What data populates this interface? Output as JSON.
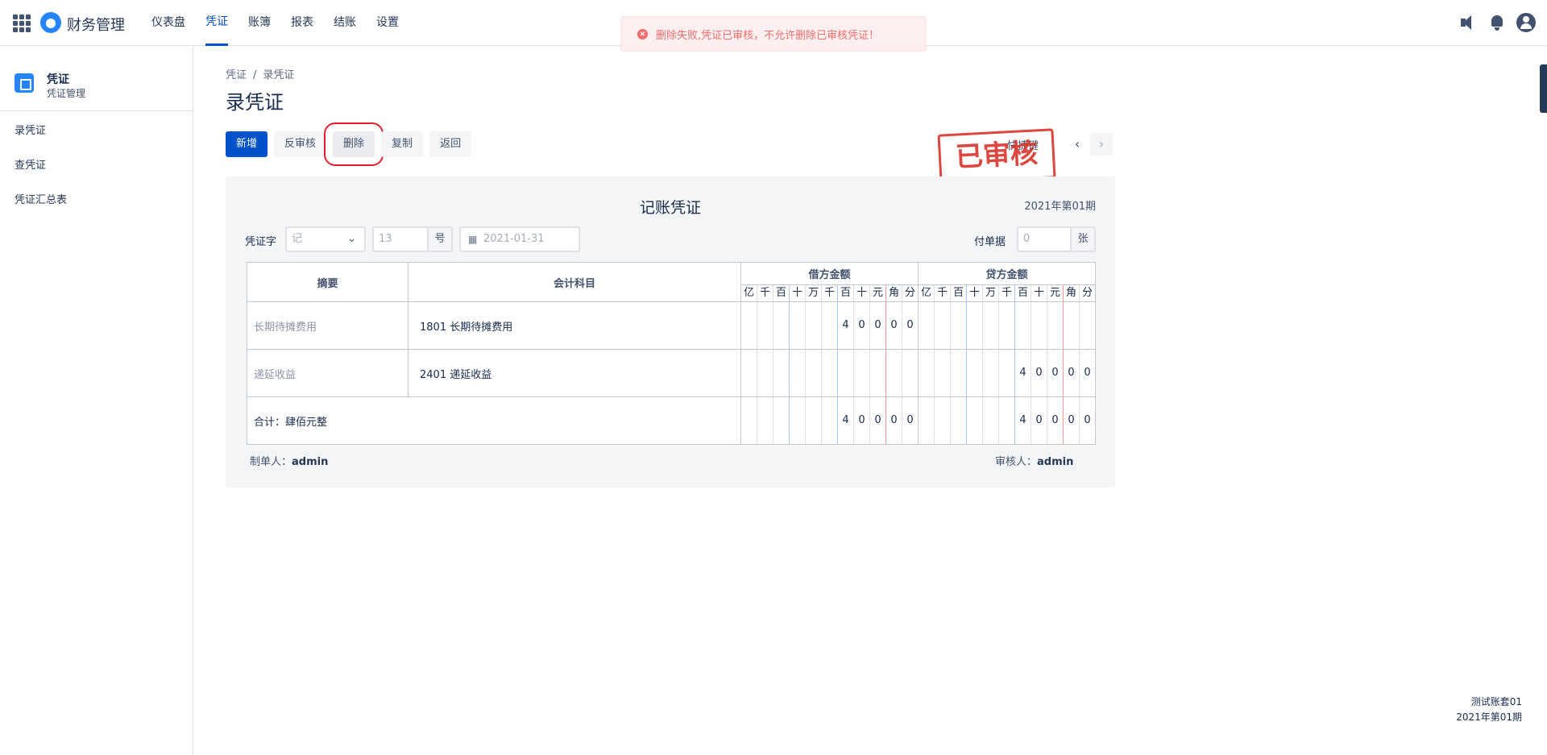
{
  "app": {
    "title": "财务管理"
  },
  "nav": [
    "仪表盘",
    "凭证",
    "账簿",
    "报表",
    "结账",
    "设置"
  ],
  "toast": {
    "message": "删除失败,凭证已审核，不允许删除已审核凭证！",
    "icon": "error-circle-icon"
  },
  "sidebar": {
    "title": "凭证",
    "subtitle": "凭证管理",
    "items": [
      "录凭证",
      "查凭证",
      "凭证汇总表"
    ]
  },
  "breadcrumb": {
    "root": "凭证",
    "sep": "/",
    "current": "录凭证"
  },
  "page_title": "录凭证",
  "toolbar": {
    "add": "新增",
    "unaudit": "反审核",
    "delete": "删除",
    "copy": "复制",
    "back": "返回"
  },
  "shortcut_label": "快捷键",
  "stamp": "已审核",
  "pager": {
    "prev": "‹",
    "next": "›"
  },
  "voucher": {
    "title": "记账凭证",
    "period": "2021年第01期",
    "word_label": "凭证字",
    "word_value": "记",
    "number_value": "13",
    "number_suffix": "号",
    "date_value": "2021-01-31",
    "attach_label": "付单据",
    "attach_value": "0",
    "attach_suffix": "张",
    "headers": {
      "summary": "摘要",
      "account": "会计科目",
      "debit": "借方金额",
      "credit": "贷方金额"
    },
    "digit_units": [
      "亿",
      "千",
      "百",
      "十",
      "万",
      "千",
      "百",
      "十",
      "元",
      "角",
      "分"
    ],
    "rows": [
      {
        "summary": "长期待摊费用",
        "account": "1801 长期待摊费用",
        "debit": [
          "",
          "",
          "",
          "",
          "",
          "",
          "4",
          "0",
          "0",
          "0",
          "0"
        ],
        "credit": [
          "",
          "",
          "",
          "",
          "",
          "",
          "",
          "",
          "",
          "",
          ""
        ]
      },
      {
        "summary": "递延收益",
        "account": "2401 递延收益",
        "debit": [
          "",
          "",
          "",
          "",
          "",
          "",
          "",
          "",
          "",
          "",
          ""
        ],
        "credit": [
          "",
          "",
          "",
          "",
          "",
          "",
          "4",
          "0",
          "0",
          "0",
          "0"
        ]
      }
    ],
    "total": {
      "label": "合计：肆佰元整",
      "debit": [
        "",
        "",
        "",
        "",
        "",
        "",
        "4",
        "0",
        "0",
        "0",
        "0"
      ],
      "credit": [
        "",
        "",
        "",
        "",
        "",
        "",
        "4",
        "0",
        "0",
        "0",
        "0"
      ]
    },
    "maker_label": "制单人：",
    "maker": "admin",
    "auditor_label": "审核人：",
    "auditor": "admin"
  },
  "footer": {
    "book": "测试账套01",
    "period": "2021年第01期"
  },
  "colors": {
    "primary": "#0052cc",
    "danger": "#f56c6c",
    "stamp": "#d9342b"
  }
}
